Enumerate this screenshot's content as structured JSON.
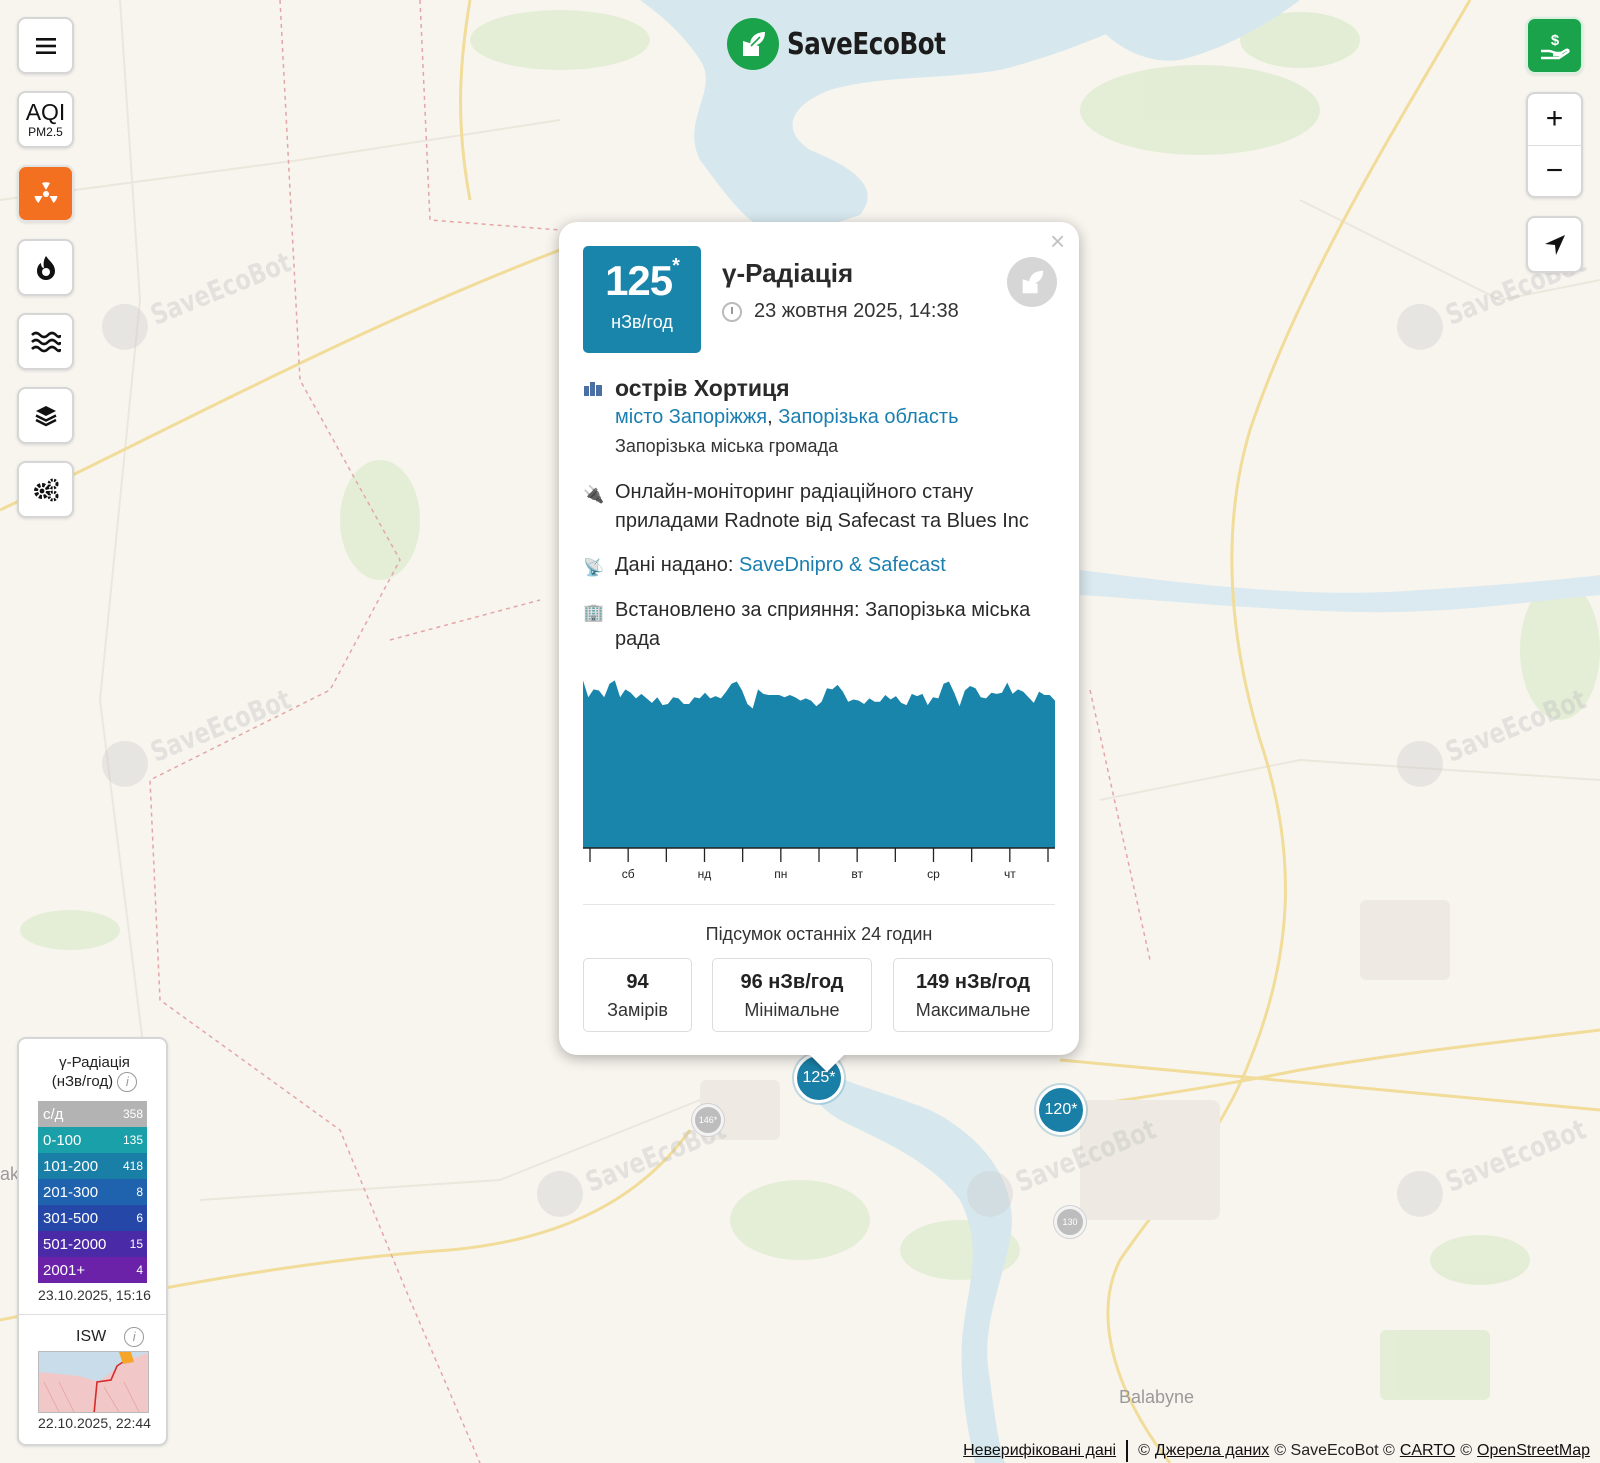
{
  "logo": {
    "text": "SaveEcoBot",
    "color": "#1aa34a"
  },
  "controls": {
    "menu_icon": "menu-icon",
    "aqi_top": "AQI",
    "aqi_bottom": "PM2.5",
    "active_color": "#f37021"
  },
  "zoom": {
    "in": "+",
    "out": "−"
  },
  "markers": [
    {
      "label": "125*",
      "kind": "big"
    },
    {
      "label": "120*",
      "kind": "big"
    },
    {
      "label": "146*",
      "kind": "small"
    },
    {
      "label": "130",
      "kind": "small"
    }
  ],
  "map_labels": {
    "town": "Balabyne",
    "edge": "ak"
  },
  "watermark": "SaveEcoBot",
  "popup": {
    "value": "125",
    "value_mark": "*",
    "unit": "нЗв/год",
    "title": "γ-Радіація",
    "date": "23 жовтня 2025, 14:38",
    "location_name": "острів Хортиця",
    "city_link": "місто Запоріжжя",
    "separator": ", ",
    "region_link": "Запорізька область",
    "community": "Запорізька міська громада",
    "description": "Онлайн-моніторинг радіаційного стану приладами Radnote від Safecast та Blues Inc",
    "provided_label": "Дані надано:",
    "provided_link": "SaveDnipro & Safecast",
    "installed": "Встановлено за сприяння: Запорізька міська рада",
    "close": "×",
    "accent": "#1a85aa",
    "summary": {
      "title": "Підсумок останніх 24 годин",
      "stats": [
        {
          "value": "94",
          "label": "Замірів"
        },
        {
          "value": "96 нЗв/год",
          "label": "Мінімальне"
        },
        {
          "value": "149 нЗв/год",
          "label": "Максимальне"
        }
      ]
    }
  },
  "chart_data": {
    "type": "area",
    "color": "#1a85aa",
    "tick_labels": [
      "сб",
      "нд",
      "пн",
      "вт",
      "ср",
      "чт"
    ],
    "ylim": [
      0,
      160
    ],
    "values": [
      149,
      134,
      141,
      140,
      134,
      146,
      149,
      134,
      141,
      138,
      133,
      137,
      133,
      129,
      134,
      127,
      128,
      134,
      133,
      128,
      128,
      134,
      133,
      138,
      133,
      135,
      133,
      139,
      146,
      148,
      140,
      128,
      124,
      141,
      137,
      136,
      136,
      136,
      134,
      136,
      134,
      131,
      133,
      131,
      126,
      130,
      142,
      141,
      145,
      139,
      130,
      132,
      131,
      128,
      133,
      130,
      130,
      136,
      132,
      135,
      129,
      127,
      137,
      135,
      137,
      127,
      134,
      133,
      146,
      148,
      138,
      126,
      140,
      144,
      142,
      134,
      133,
      138,
      137,
      138,
      147,
      137,
      141,
      139,
      134,
      129,
      139,
      136,
      136,
      131
    ]
  },
  "legend": {
    "title": "γ-Радіація",
    "unit": "(нЗв/год)",
    "info": "i",
    "rows": [
      {
        "range": "с/д",
        "count": "358",
        "color": "#b3b3b3"
      },
      {
        "range": "0-100",
        "count": "135",
        "color": "#1aa0a8"
      },
      {
        "range": "101-200",
        "count": "418",
        "color": "#1a7fa6"
      },
      {
        "range": "201-300",
        "count": "8",
        "color": "#1f62ad"
      },
      {
        "range": "301-500",
        "count": "6",
        "color": "#2447a8"
      },
      {
        "range": "501-2000",
        "count": "15",
        "color": "#4b2aa8"
      },
      {
        "range": "2001+",
        "count": "4",
        "color": "#6b22a8"
      }
    ],
    "date": "23.10.2025, 15:16",
    "isw_label": "ISW",
    "isw_date": "22.10.2025, 22:44"
  },
  "attribution": {
    "unverified": "Неверифіковані дані",
    "c1": "©",
    "sources": "Джерела даних",
    "c2": "© SaveEcoBot ©",
    "carto": "CARTO",
    "c3": "©",
    "osm": "OpenStreetMap"
  }
}
